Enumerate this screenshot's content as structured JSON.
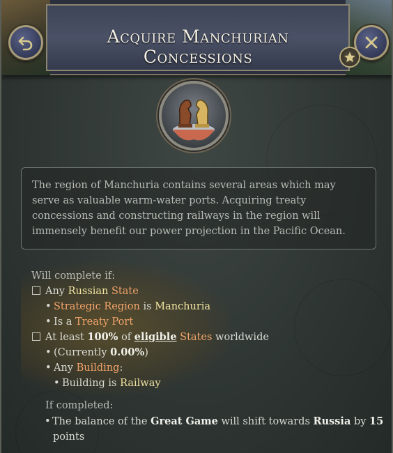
{
  "header": {
    "title": "Acquire Manchurian Concessions"
  },
  "icons": {
    "back": "undo-arrow-icon",
    "close": "close-x-icon",
    "star": "star-icon",
    "illustration": "chess-knights-on-hand-icon"
  },
  "description": "The region of Manchuria contains several areas which may serve as valuable warm-water ports. Acquiring treaty concessions and constructing railways in the region will immensely benefit our power projection in the Pacific Ocean.",
  "requirements": {
    "heading": "Will complete if:",
    "cond1": {
      "any": "Any",
      "russian": "Russian",
      "state": "State",
      "sub1_key": "Strategic Region",
      "sub1_is": "is",
      "sub1_val": "Manchuria",
      "sub2_is": "Is a",
      "sub2_val": "Treaty Port"
    },
    "cond2": {
      "at_least": "At least",
      "percent": "100%",
      "of": "of",
      "eligible": "eligible",
      "states": "States",
      "worldwide": "worldwide",
      "current_open": "(Currently",
      "current_val": "0.00%",
      "current_close": ")",
      "any": "Any",
      "building": "Building",
      "colon": ":",
      "building_is": "Building is",
      "railway": "Railway"
    }
  },
  "completion": {
    "heading": "If completed:",
    "pre": "The balance of the",
    "great_game": "Great Game",
    "mid": "will shift towards",
    "country": "Russia",
    "by": "by",
    "points_num": "15",
    "points": "points"
  },
  "colors": {
    "highlight_yellow": "#f1e4a2",
    "highlight_orange": "#f2a46a",
    "header_blue": "#3d4457"
  }
}
